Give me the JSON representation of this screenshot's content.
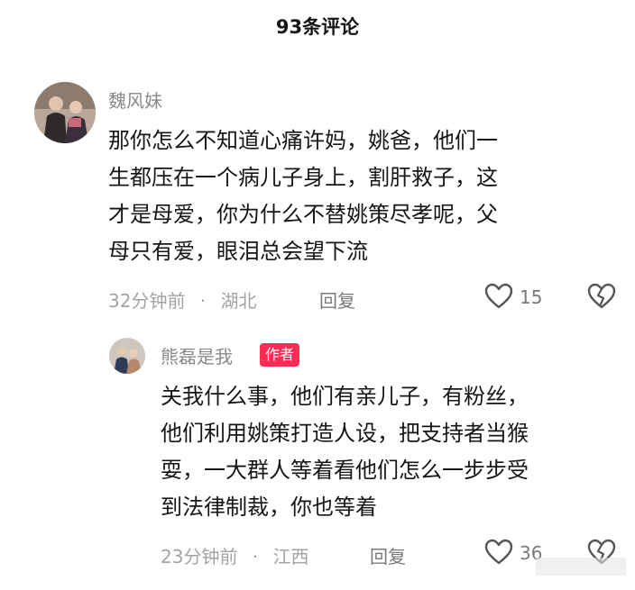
{
  "header": {
    "title": "93条评论"
  },
  "comments": [
    {
      "username": "魏风妹",
      "body_lines": [
        "那你怎么不知道心痛许妈，姚爸，他们一",
        "生都压在一个病儿子身上，割肝救子，这",
        "才是母爱，你为什么不替姚策尽孝呢，父",
        "母只有爱，眼泪总会望下流"
      ],
      "time": "32分钟前",
      "location": "湖北",
      "meta_separator": "·",
      "reply_label": "回复",
      "like_count": "15"
    }
  ],
  "reply": {
    "username": "熊磊是我",
    "badge": "作者",
    "badge_color": "#fe2c55",
    "body_lines": [
      "关我什么事，他们有亲儿子，有粉丝，",
      "他们利用姚策打造人设，把支持者当猴",
      "耍，一大群人等着看他们怎么一步步受",
      "到法律制裁，你也等着"
    ],
    "time": "23分钟前",
    "location": "江西",
    "meta_separator": "·",
    "reply_label": "回复",
    "like_count": "36"
  }
}
